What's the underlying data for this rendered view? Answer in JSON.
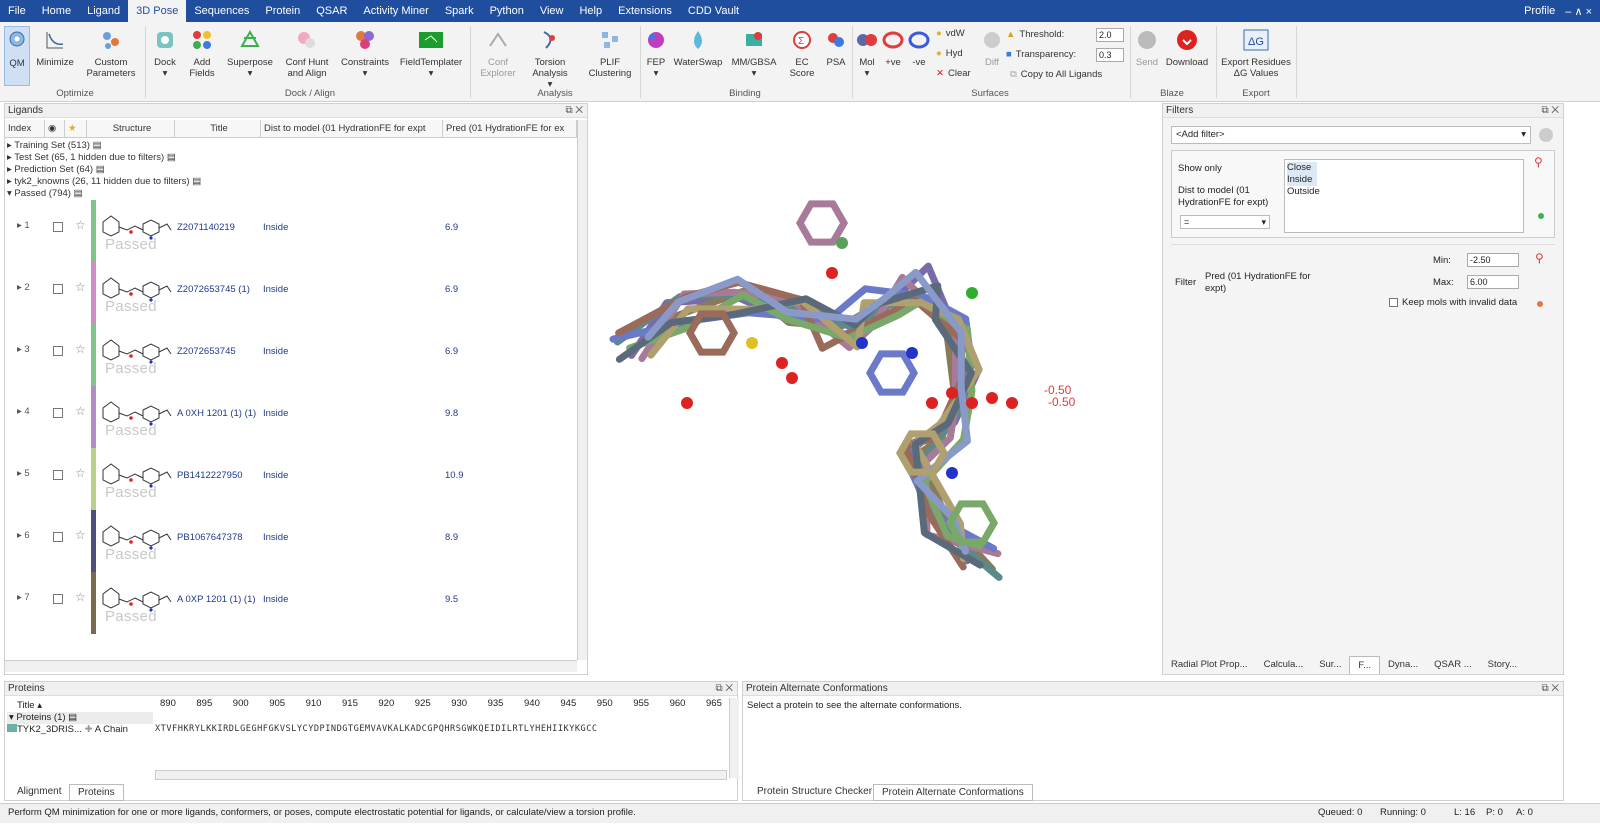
{
  "menu": {
    "items": [
      "File",
      "Home",
      "Ligand",
      "3D Pose",
      "Sequences",
      "Protein",
      "QSAR",
      "Activity Miner",
      "Spark",
      "Python",
      "View",
      "Help",
      "Extensions",
      "CDD Vault"
    ],
    "profile": "Profile",
    "controls": "– ∧ ×"
  },
  "ribbon": {
    "optimize": {
      "group": "Optimize",
      "qm": "QM",
      "minimize": "Minimize",
      "custom": "Custom Parameters"
    },
    "dock": {
      "group": "Dock / Align",
      "dock": "Dock",
      "add_fields": "Add Fields",
      "superpose": "Superpose",
      "conf_hunt": "Conf Hunt and Align",
      "constraints": "Constraints",
      "field_templater": "FieldTemplater"
    },
    "analysis": {
      "group": "Analysis",
      "conf_explorer": "Conf Explorer",
      "torsion": "Torsion Analysis",
      "plif": "PLIF Clustering"
    },
    "binding": {
      "group": "Binding",
      "fep": "FEP",
      "waterswap": "WaterSwap",
      "mmgbsa": "MM/GBSA",
      "ec_score": "EC Score",
      "psa": "PSA"
    },
    "surfaces": {
      "group": "Surfaces",
      "mol": "Mol",
      "pos": "+ve",
      "neg": "-ve",
      "vdw": "vdW",
      "hyd": "Hyd",
      "clear": "Clear",
      "diff": "Diff",
      "threshold_label": "Threshold:",
      "threshold": "2.0",
      "transparency_label": "Transparency:",
      "transparency": "0.3",
      "copy_all": "Copy to All Ligands"
    },
    "blaze": {
      "group": "Blaze",
      "send": "Send",
      "download": "Download"
    },
    "export": {
      "group": "Export",
      "export_residues": "Export Residues ΔG Values"
    }
  },
  "ligands": {
    "title": "Ligands",
    "columns": [
      "Index",
      "",
      "",
      "Structure",
      "Title",
      "Dist to model (01 HydrationFE for expt",
      "Pred (01 HydrationFE for ex"
    ],
    "sets": [
      "Training Set (513)",
      "Test Set (65, 1 hidden due to filters)",
      "Prediction Set (64)",
      "tyk2_knowns (26, 11 hidden due to filters)",
      "Passed (794)"
    ],
    "rows": [
      {
        "index": "1",
        "title": "Z2071140219",
        "dist": "Inside",
        "pred": "6.9",
        "status": "Passed",
        "color": "#7fc58a"
      },
      {
        "index": "2",
        "title": "Z2072653745 (1)",
        "dist": "Inside",
        "pred": "6.9",
        "status": "Passed",
        "color": "#d08cc4"
      },
      {
        "index": "3",
        "title": "Z2072653745",
        "dist": "Inside",
        "pred": "6.9",
        "status": "Passed",
        "color": "#7fc58a"
      },
      {
        "index": "4",
        "title": "A 0XH 1201 (1) (1)",
        "dist": "Inside",
        "pred": "9.8",
        "status": "Passed",
        "color": "#b28bc9"
      },
      {
        "index": "5",
        "title": "PB1412227950",
        "dist": "Inside",
        "pred": "10.9",
        "status": "Passed",
        "color": "#b8d08a"
      },
      {
        "index": "6",
        "title": "PB1067647378",
        "dist": "Inside",
        "pred": "8.9",
        "status": "Passed",
        "color": "#4b4f7a"
      },
      {
        "index": "7",
        "title": "A 0XP 1201 (1) (1)",
        "dist": "Inside",
        "pred": "9.5",
        "status": "Passed",
        "color": "#7a6a52"
      }
    ]
  },
  "viewer": {
    "label1": "-0.50",
    "label2": "-0.50"
  },
  "filters": {
    "title": "Filters",
    "add_filter": "<Add filter>",
    "show_only": "Show only",
    "options": [
      "Close",
      "Inside",
      "Outside"
    ],
    "dist_label": "Dist to model (01 HydrationFE for expt)",
    "operator": "=",
    "filter_label": "Filter",
    "pred_label": "Pred (01 HydrationFE for expt)",
    "min_label": "Min:",
    "min": "-2.50",
    "max_label": "Max:",
    "max": "6.00",
    "keep_invalid": "Keep mols with invalid data",
    "tabs": [
      "Radial Plot Prop...",
      "Calcula...",
      "Sur...",
      "F...",
      "Dyna...",
      "QSAR ...",
      "Story..."
    ]
  },
  "proteins": {
    "title": "Proteins",
    "ticks": [
      "890",
      "895",
      "900",
      "905",
      "910",
      "915",
      "920",
      "925",
      "930",
      "935",
      "940",
      "945",
      "950",
      "955",
      "960",
      "965"
    ],
    "title_col": "Title",
    "group": "Proteins (1)",
    "protein_name": "TYK2_3DRIS...",
    "chain": "A Chain",
    "sequence": "XTVFHKRYLKKIRDLGEGHFGKVSLYCYDPINDGTGEMVAVKALKADCGPQHRSGWKQEIDILRTLYHEHIIKYKGCC",
    "tabs": [
      "Alignment",
      "Proteins"
    ]
  },
  "altconf": {
    "title": "Protein Alternate Conformations",
    "message": "Select a protein to see the alternate conformations.",
    "tabs": [
      "Protein Structure Checker",
      "Protein Alternate Conformations"
    ]
  },
  "status": {
    "message": "Perform QM minimization for one or more ligands, conformers, or poses, compute electrostatic potential for ligands, or calculate/view a torsion profile.",
    "queued": "Queued: 0",
    "running": "Running: 0",
    "l": "L: 16",
    "p": "P: 0",
    "a": "A: 0"
  },
  "colors": {
    "menu": "#1f4e9e",
    "link": "#1f3a8a"
  }
}
